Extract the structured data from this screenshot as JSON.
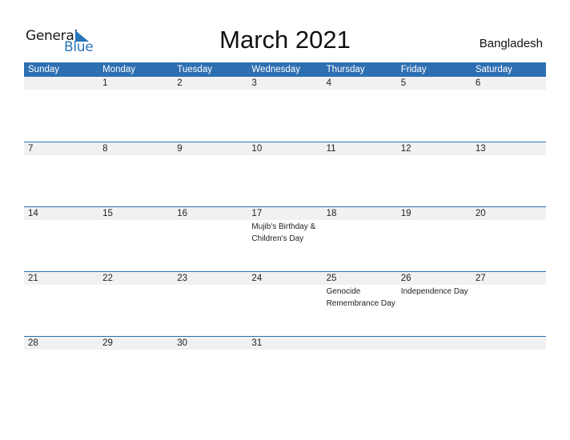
{
  "logo": {
    "word1": "General",
    "word2": "Blue",
    "icon": "blue-triangle-icon"
  },
  "header": {
    "title": "March 2021",
    "country": "Bangladesh"
  },
  "colors": {
    "accent": "#2e6fb2",
    "date_strip": "#f1f1f1",
    "logo_blue": "#2a74b9"
  },
  "weekdays": [
    "Sunday",
    "Monday",
    "Tuesday",
    "Wednesday",
    "Thursday",
    "Friday",
    "Saturday"
  ],
  "weeks": [
    [
      {
        "day": ""
      },
      {
        "day": "1"
      },
      {
        "day": "2"
      },
      {
        "day": "3"
      },
      {
        "day": "4"
      },
      {
        "day": "5"
      },
      {
        "day": "6"
      }
    ],
    [
      {
        "day": "7"
      },
      {
        "day": "8"
      },
      {
        "day": "9"
      },
      {
        "day": "10"
      },
      {
        "day": "11"
      },
      {
        "day": "12"
      },
      {
        "day": "13"
      }
    ],
    [
      {
        "day": "14"
      },
      {
        "day": "15"
      },
      {
        "day": "16"
      },
      {
        "day": "17",
        "event": "Mujib's Birthday & Children's Day"
      },
      {
        "day": "18"
      },
      {
        "day": "19"
      },
      {
        "day": "20"
      }
    ],
    [
      {
        "day": "21"
      },
      {
        "day": "22"
      },
      {
        "day": "23"
      },
      {
        "day": "24"
      },
      {
        "day": "25",
        "event": "Genocide Remembrance Day"
      },
      {
        "day": "26",
        "event": "Independence Day"
      },
      {
        "day": "27"
      }
    ],
    [
      {
        "day": "28"
      },
      {
        "day": "29"
      },
      {
        "day": "30"
      },
      {
        "day": "31"
      },
      {
        "day": ""
      },
      {
        "day": ""
      },
      {
        "day": ""
      }
    ]
  ]
}
